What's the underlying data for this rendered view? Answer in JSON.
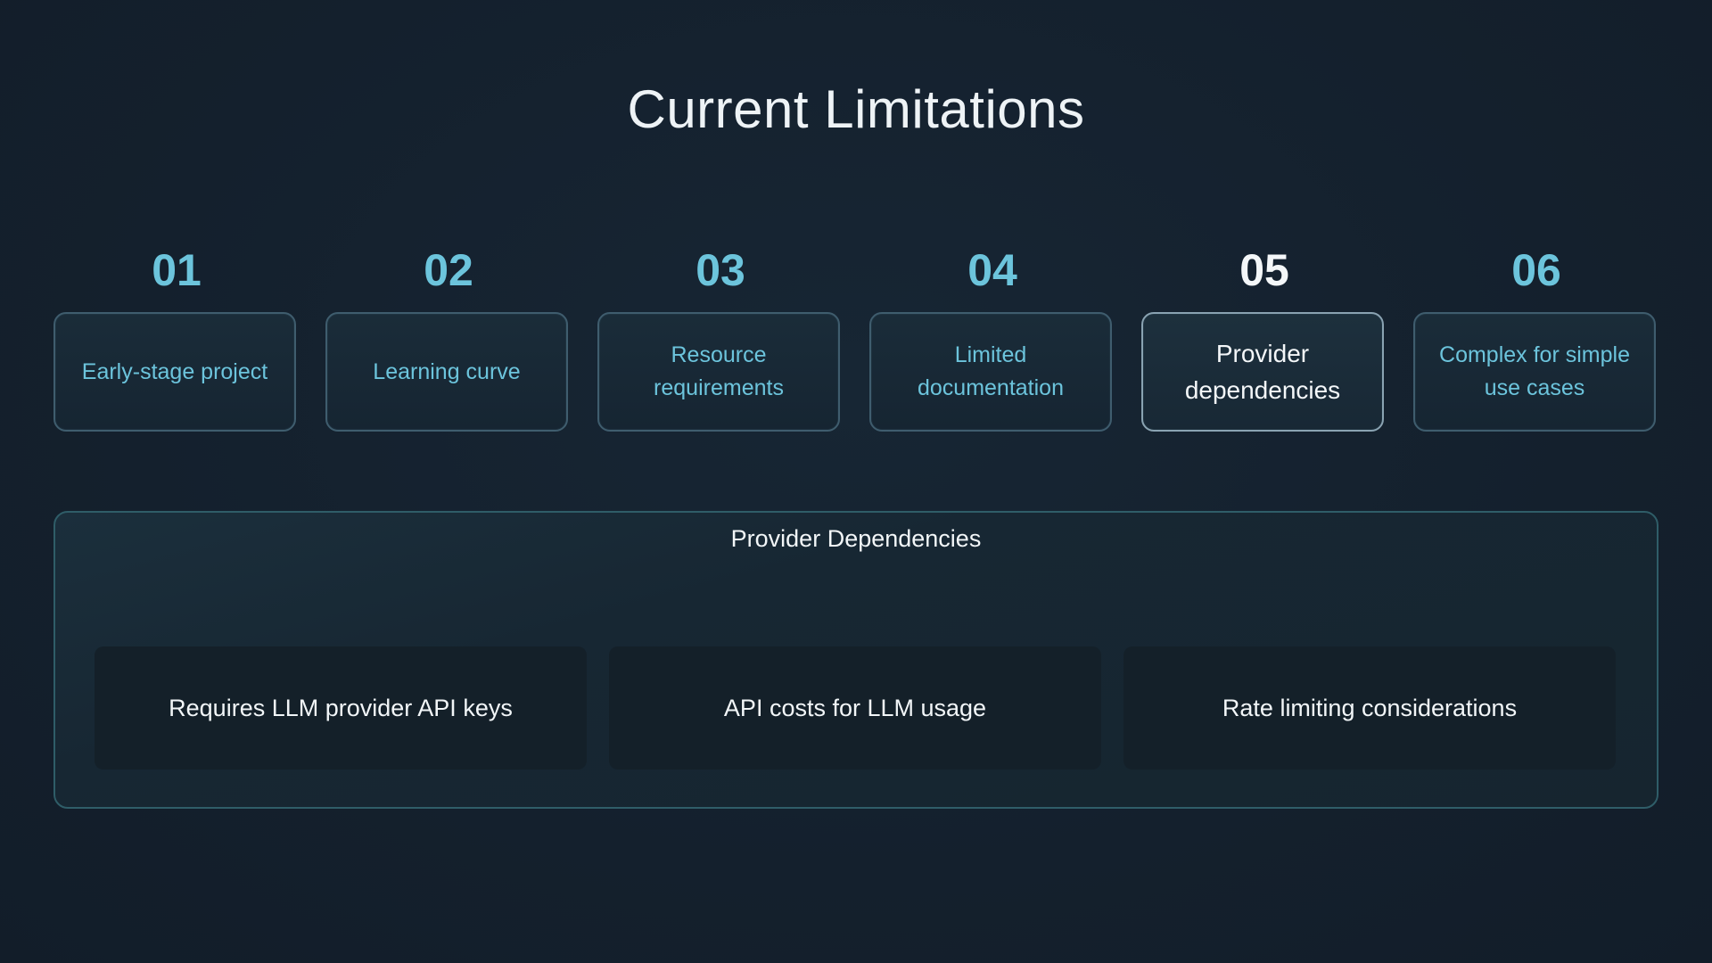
{
  "slide": {
    "title": "Current Limitations",
    "items": [
      {
        "number": "01",
        "label": "Early-stage project",
        "active": false
      },
      {
        "number": "02",
        "label": "Learning curve",
        "active": false
      },
      {
        "number": "03",
        "label": "Resource requirements",
        "active": false
      },
      {
        "number": "04",
        "label": "Limited documentation",
        "active": false
      },
      {
        "number": "05",
        "label": "Provider dependencies",
        "active": true
      },
      {
        "number": "06",
        "label": "Complex for simple use cases",
        "active": false
      }
    ],
    "detail": {
      "title": "Provider Dependencies",
      "points": [
        "Requires LLM provider API keys",
        "API costs for LLM usage",
        "Rate limiting considerations"
      ]
    }
  },
  "colors": {
    "background": "#14202d",
    "accent": "#6cc4dc",
    "active_text": "#f4f7f9",
    "card_border": "#3f5d6e",
    "panel_border": "#2f5d68"
  }
}
